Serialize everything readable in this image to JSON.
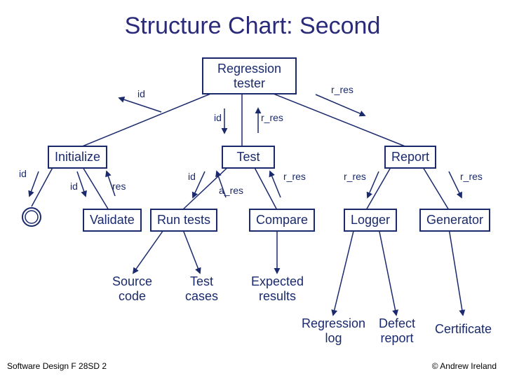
{
  "title": "Structure Chart: Second",
  "boxes": {
    "root": "Regression\ntester",
    "initialize": "Initialize",
    "test": "Test",
    "report": "Report",
    "validate": "Validate",
    "run_tests": "Run tests",
    "compare": "Compare",
    "logger": "Logger",
    "generator": "Generator"
  },
  "plain": {
    "source_code": "Source\ncode",
    "test_cases": "Test\ncases",
    "expected_results": "Expected\nresults",
    "regression_log": "Regression\nlog",
    "defect_report": "Defect\nreport",
    "certificate": "Certificate"
  },
  "labels": {
    "id": "id",
    "res": "res",
    "r_res": "r_res",
    "a_res": "a_res"
  },
  "footer": {
    "left": "Software Design F 28SD 2",
    "right": "© Andrew Ireland"
  }
}
